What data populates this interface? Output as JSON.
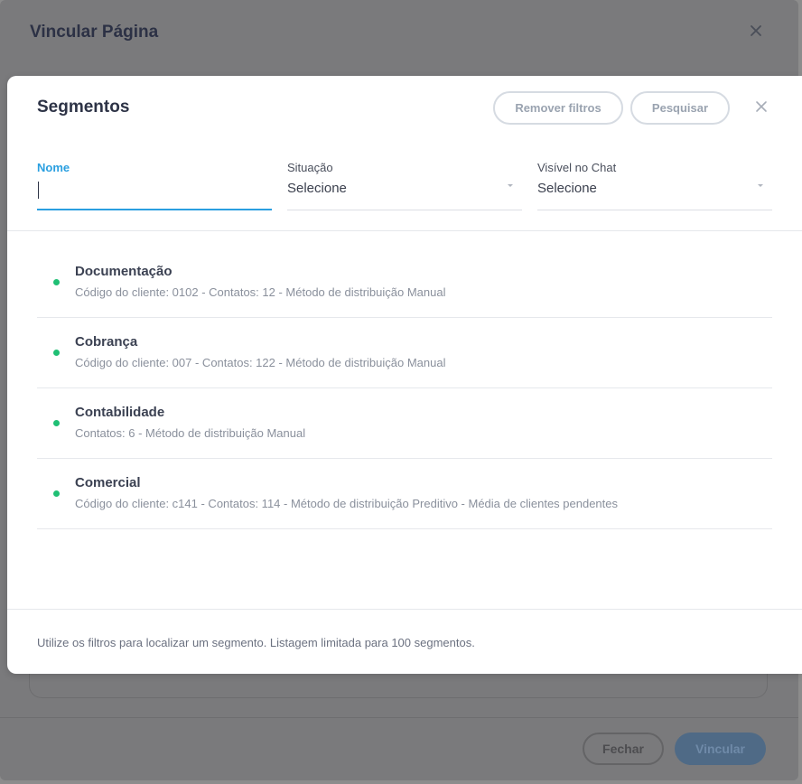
{
  "background_modal": {
    "title": "Vincular Página",
    "buttons": {
      "fechar": "Fechar",
      "vincular": "Vincular"
    }
  },
  "modal": {
    "title": "Segmentos",
    "buttons": {
      "remover_filtros": "Remover filtros",
      "pesquisar": "Pesquisar"
    },
    "filters": {
      "nome": {
        "label": "Nome",
        "value": ""
      },
      "situacao": {
        "label": "Situação",
        "value": "Selecione"
      },
      "visivel_chat": {
        "label": "Visível no Chat",
        "value": "Selecione"
      }
    },
    "segments": [
      {
        "name": "Documentação",
        "details": "Código do cliente: 0102 - Contatos: 12 - Método de distribuição Manual",
        "status_color": "#1fbf74"
      },
      {
        "name": "Cobrança",
        "details": "Código do cliente: 007 - Contatos: 122 - Método de distribuição Manual",
        "status_color": "#1fbf74"
      },
      {
        "name": "Contabilidade",
        "details": "Contatos: 6 - Método de distribuição Manual",
        "status_color": "#1fbf74"
      },
      {
        "name": "Comercial",
        "details": "Código do cliente: c141 - Contatos: 114 - Método de distribuição Preditivo - Média de clientes pendentes",
        "status_color": "#1fbf74"
      }
    ],
    "footer": "Utilize os filtros para localizar um segmento. Listagem limitada para 100 segmentos."
  },
  "colors": {
    "accent": "#2a9fe0",
    "status_active": "#1fbf74"
  },
  "icons": [
    "close-icon",
    "chevron-down-icon",
    "status-dot-icon"
  ]
}
